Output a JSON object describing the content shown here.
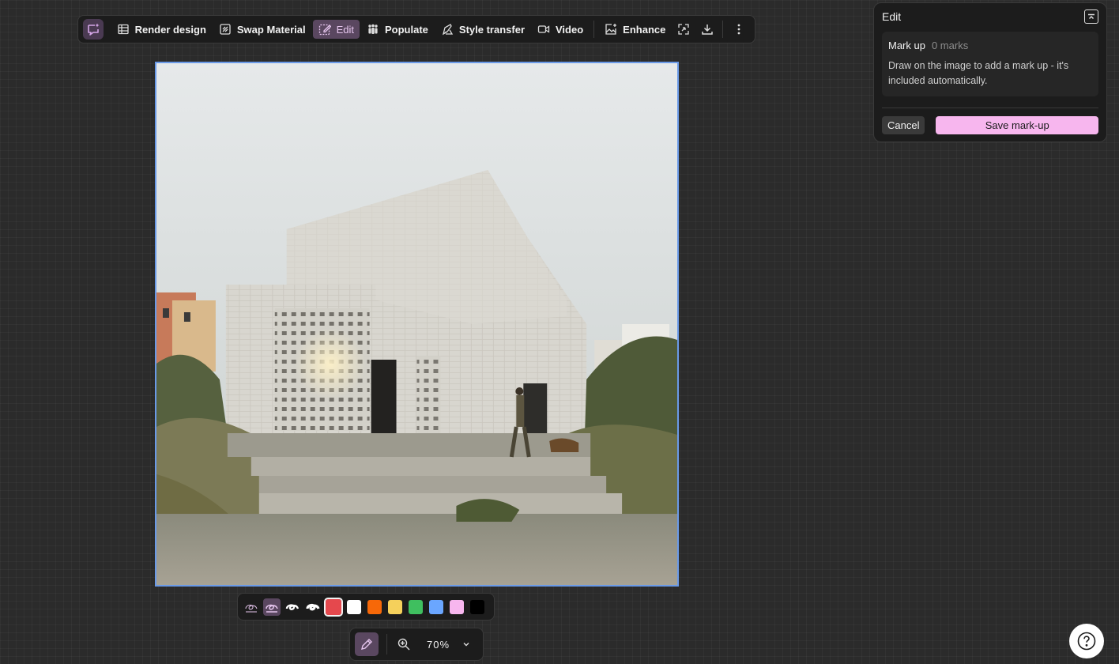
{
  "toolbar": {
    "logo_icon": "sparkle-chat-icon",
    "items": [
      {
        "label": "Render design",
        "icon": "grid-icon"
      },
      {
        "label": "Swap Material",
        "icon": "material-icon"
      },
      {
        "label": "Edit",
        "icon": "edit-pencil-icon",
        "active": true
      },
      {
        "label": "Populate",
        "icon": "people-icon"
      },
      {
        "label": "Style transfer",
        "icon": "style-brush-icon"
      },
      {
        "label": "Video",
        "icon": "video-icon"
      },
      {
        "label": "Enhance",
        "icon": "enhance-image-icon"
      }
    ],
    "extra_icons": [
      "expand-icon",
      "download-icon",
      "more-vertical-icon"
    ]
  },
  "edit_panel": {
    "title": "Edit",
    "markup_label": "Mark up",
    "markup_count": "0 marks",
    "description": "Draw on the image to add a mark up - it's included automatically.",
    "cancel_label": "Cancel",
    "save_label": "Save mark-up"
  },
  "markup_bar": {
    "brush_sizes": [
      "xs",
      "s",
      "m",
      "l"
    ],
    "selected_brush": 1,
    "colors": [
      "#e5484d",
      "#ffffff",
      "#f76808",
      "#f5d05b",
      "#3fbf5f",
      "#6aa6ff",
      "#f7b6ee",
      "#000000"
    ],
    "selected_color": 0
  },
  "zoom_bar": {
    "zoom_value": "70%"
  },
  "colors": {
    "accent": "#f7b6ee",
    "active_bg": "#5a4760",
    "selection_border": "#6a9ae8",
    "panel_bg": "#1c1c1c"
  }
}
